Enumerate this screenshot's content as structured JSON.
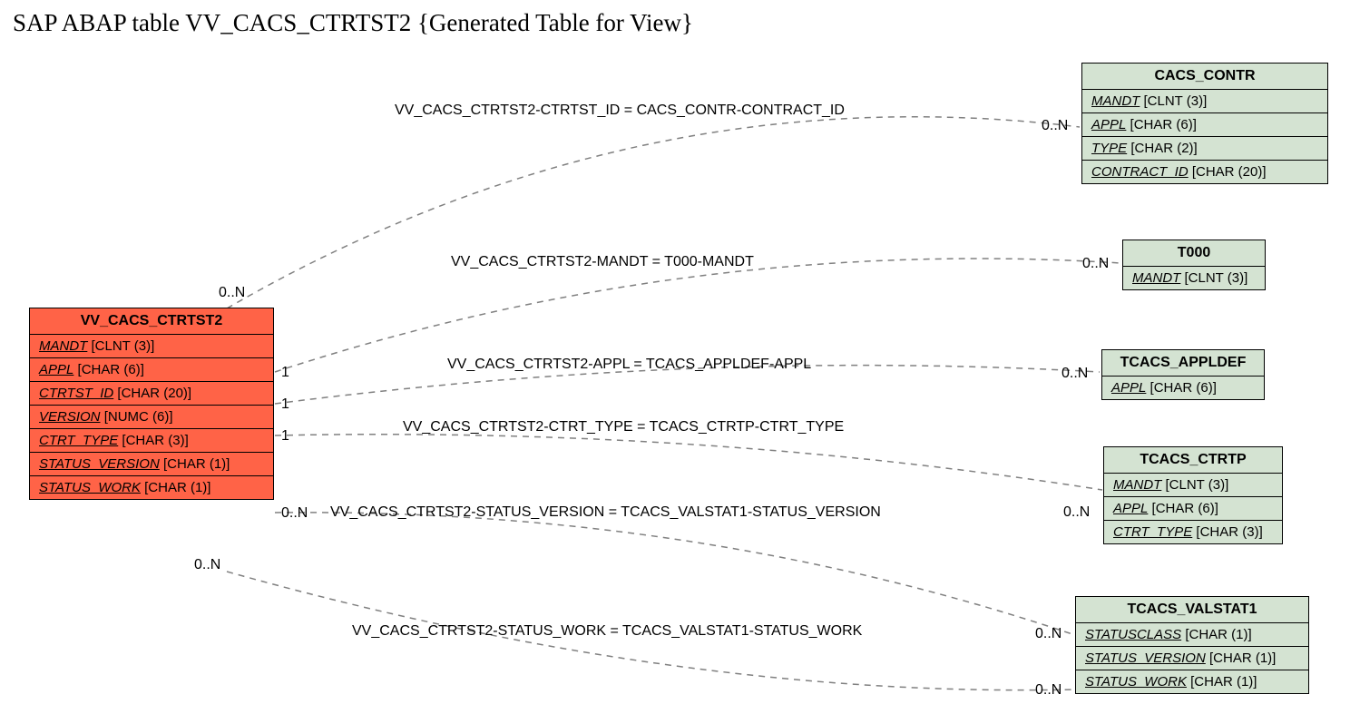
{
  "title": "SAP ABAP table VV_CACS_CTRTST2 {Generated Table for View}",
  "main_entity": {
    "name": "VV_CACS_CTRTST2",
    "fields": [
      {
        "name": "MANDT",
        "type": "[CLNT (3)]"
      },
      {
        "name": "APPL",
        "type": "[CHAR (6)]"
      },
      {
        "name": "CTRTST_ID",
        "type": "[CHAR (20)]"
      },
      {
        "name": "VERSION",
        "type": "[NUMC (6)]"
      },
      {
        "name": "CTRT_TYPE",
        "type": "[CHAR (3)]"
      },
      {
        "name": "STATUS_VERSION",
        "type": "[CHAR (1)]"
      },
      {
        "name": "STATUS_WORK",
        "type": "[CHAR (1)]"
      }
    ]
  },
  "entities": {
    "cacs_contr": {
      "name": "CACS_CONTR",
      "fields": [
        {
          "name": "MANDT",
          "type": "[CLNT (3)]"
        },
        {
          "name": "APPL",
          "type": "[CHAR (6)]"
        },
        {
          "name": "TYPE",
          "type": "[CHAR (2)]"
        },
        {
          "name": "CONTRACT_ID",
          "type": "[CHAR (20)]"
        }
      ]
    },
    "t000": {
      "name": "T000",
      "fields": [
        {
          "name": "MANDT",
          "type": "[CLNT (3)]"
        }
      ]
    },
    "tcacs_appldef": {
      "name": "TCACS_APPLDEF",
      "fields": [
        {
          "name": "APPL",
          "type": "[CHAR (6)]"
        }
      ]
    },
    "tcacs_ctrtp": {
      "name": "TCACS_CTRTP",
      "fields": [
        {
          "name": "MANDT",
          "type": "[CLNT (3)]"
        },
        {
          "name": "APPL",
          "type": "[CHAR (6)]"
        },
        {
          "name": "CTRT_TYPE",
          "type": "[CHAR (3)]"
        }
      ]
    },
    "tcacs_valstat1": {
      "name": "TCACS_VALSTAT1",
      "fields": [
        {
          "name": "STATUSCLASS",
          "type": "[CHAR (1)]"
        },
        {
          "name": "STATUS_VERSION",
          "type": "[CHAR (1)]"
        },
        {
          "name": "STATUS_WORK",
          "type": "[CHAR (1)]"
        }
      ]
    }
  },
  "edges": {
    "e1": "VV_CACS_CTRTST2-CTRTST_ID = CACS_CONTR-CONTRACT_ID",
    "e2": "VV_CACS_CTRTST2-MANDT = T000-MANDT",
    "e3": "VV_CACS_CTRTST2-APPL = TCACS_APPLDEF-APPL",
    "e4": "VV_CACS_CTRTST2-CTRT_TYPE = TCACS_CTRTP-CTRT_TYPE",
    "e5": "VV_CACS_CTRTST2-STATUS_VERSION = TCACS_VALSTAT1-STATUS_VERSION",
    "e6": "VV_CACS_CTRTST2-STATUS_WORK = TCACS_VALSTAT1-STATUS_WORK"
  },
  "card": {
    "zn": "0..N",
    "one": "1"
  }
}
